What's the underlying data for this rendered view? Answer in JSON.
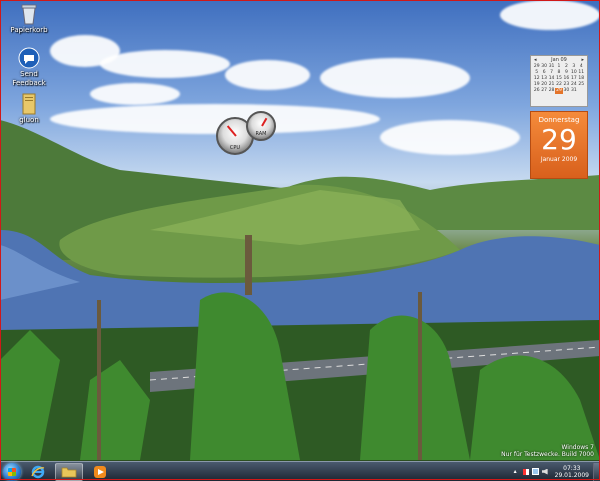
{
  "desktop": {
    "icons": [
      {
        "label": "Papierkorb",
        "icon": "recycle-bin-icon"
      },
      {
        "label": "Send Feedback",
        "icon": "feedback-icon"
      },
      {
        "label": "gluon",
        "icon": "folder-icon"
      }
    ]
  },
  "gadgets": {
    "calendar": {
      "month_header": "Jan 09",
      "weekday_row": [
        "",
        "",
        "",
        "",
        "",
        "",
        ""
      ],
      "weekday": "Donnerstag",
      "day": "29",
      "month_year": "Januar 2009",
      "grid": [
        "29",
        "30",
        "31",
        "1",
        "2",
        "3",
        "4",
        "5",
        "6",
        "7",
        "8",
        "9",
        "10",
        "11",
        "12",
        "13",
        "14",
        "15",
        "16",
        "17",
        "18",
        "19",
        "20",
        "21",
        "22",
        "23",
        "24",
        "25",
        "26",
        "27",
        "28",
        "29",
        "30",
        "31",
        ""
      ]
    },
    "meters": {
      "cpu_label": "CPU",
      "mem_label": "RAM"
    }
  },
  "watermark": {
    "line1": "Windows 7",
    "line2": "Nur für Testzwecke. Build 7000"
  },
  "taskbar": {
    "time": "07:33",
    "date": "29.01.2009",
    "pinned": [
      {
        "icon": "internet-explorer-icon",
        "active": false
      },
      {
        "icon": "explorer-folder-icon",
        "active": true
      },
      {
        "icon": "media-player-icon",
        "active": false
      }
    ]
  },
  "colors": {
    "frame": "#d01818",
    "calendar_accent": "#e4742a"
  }
}
